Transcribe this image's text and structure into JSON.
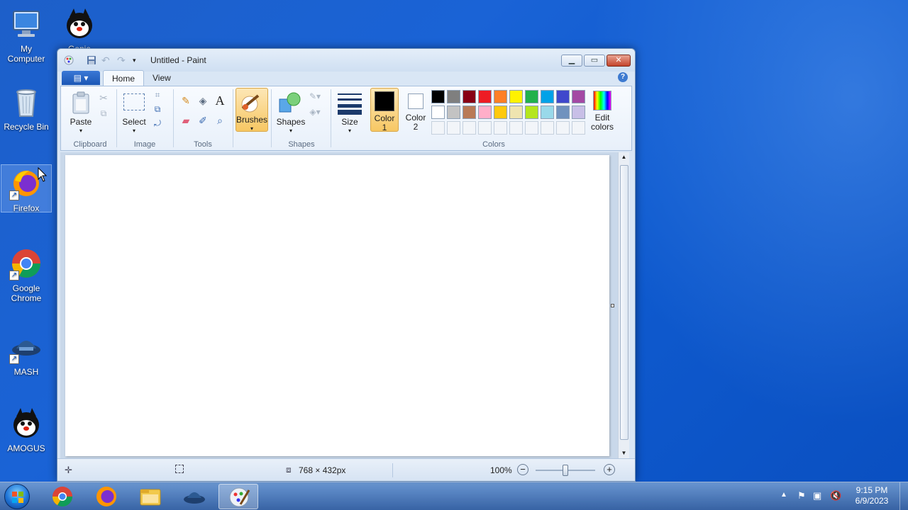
{
  "desktop": {
    "icons": [
      {
        "label": "My\nComputer",
        "name": "my-computer"
      },
      {
        "label": "Genie",
        "name": "genie"
      },
      {
        "label": "Recycle Bin",
        "name": "recycle-bin"
      },
      {
        "label": "Firefox",
        "name": "firefox"
      },
      {
        "label": "Google\nChrome",
        "name": "google-chrome"
      },
      {
        "label": "MASH",
        "name": "mash"
      },
      {
        "label": "AMOGUS",
        "name": "amogus"
      }
    ]
  },
  "window": {
    "title": "Untitled - Paint",
    "tabs": {
      "home": "Home",
      "view": "View"
    },
    "ribbon": {
      "clipboard": {
        "paste": "Paste",
        "group": "Clipboard"
      },
      "image": {
        "select": "Select",
        "group": "Image"
      },
      "tools": {
        "group": "Tools",
        "text_tool": "A"
      },
      "brushes": {
        "label": "Brushes"
      },
      "shapes": {
        "label": "Shapes",
        "group": "Shapes"
      },
      "size": {
        "label": "Size"
      },
      "color1": {
        "line1": "Color",
        "line2": "1",
        "value": "#000000"
      },
      "color2": {
        "line1": "Color",
        "line2": "2",
        "value": "#ffffff"
      },
      "colors": {
        "group": "Colors"
      },
      "edit_colors": {
        "line1": "Edit",
        "line2": "colors"
      },
      "palette_row1": [
        "#000000",
        "#7f7f7f",
        "#880015",
        "#ed1c24",
        "#ff7f27",
        "#fff200",
        "#22b14c",
        "#00a2e8",
        "#3f48cc",
        "#a349a4"
      ],
      "palette_row2": [
        "#ffffff",
        "#c3c3c3",
        "#b97a57",
        "#ffaec9",
        "#ffc90e",
        "#efe4b0",
        "#b5e61d",
        "#99d9ea",
        "#7092be",
        "#c8bfe7"
      ]
    },
    "status": {
      "dimensions": "768 × 432px",
      "zoom": "100%"
    }
  },
  "taskbar": {
    "time": "9:15 PM",
    "date": "6/9/2023"
  }
}
